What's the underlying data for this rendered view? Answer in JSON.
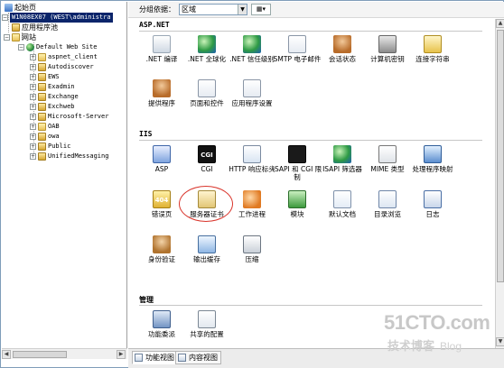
{
  "tree": {
    "start_page": "起始页",
    "server": "W1N08EX07 (WEST\\administra",
    "app_pools": "应用程序池",
    "sites": "网站",
    "default_site": "Default Web Site",
    "children": [
      "aspnet_client",
      "Autodiscover",
      "EWS",
      "Exadmin",
      "Exchange",
      "Exchweb",
      "Microsoft-Server",
      "OAB",
      "owa",
      "Public",
      "UnifiedMessaging"
    ]
  },
  "toolbar": {
    "group_label": "分组依据：",
    "group_value": "区域"
  },
  "sections": {
    "aspnet": "ASP.NET",
    "iis": "IIS",
    "manage": "管理"
  },
  "aspnet_items": [
    {
      "label": ".NET 编译",
      "icon": "net-compile-icon"
    },
    {
      "label": ".NET 全球化",
      "icon": "globalization-icon"
    },
    {
      "label": ".NET 信任级别",
      "icon": "trust-level-icon"
    },
    {
      "label": "SMTP 电子邮件",
      "icon": "smtp-email-icon"
    },
    {
      "label": "会话状态",
      "icon": "session-state-icon"
    },
    {
      "label": "计算机密钥",
      "icon": "machine-key-icon"
    },
    {
      "label": "连接字符串",
      "icon": "connection-strings-icon"
    },
    {
      "label": "提供程序",
      "icon": "providers-icon"
    },
    {
      "label": "页面和控件",
      "icon": "pages-controls-icon"
    },
    {
      "label": "应用程序设置",
      "icon": "app-settings-icon"
    }
  ],
  "iis_items": [
    {
      "label": "ASP",
      "icon": "asp-icon"
    },
    {
      "label": "CGI",
      "icon": "cgi-icon",
      "glyph": "CGI"
    },
    {
      "label": "HTTP 响应标头",
      "icon": "http-headers-icon"
    },
    {
      "label": "ISAPI 和 CGI 限制",
      "icon": "isapi-cgi-icon"
    },
    {
      "label": "ISAPI 筛选器",
      "icon": "isapi-filters-icon"
    },
    {
      "label": "MIME 类型",
      "icon": "mime-types-icon"
    },
    {
      "label": "处理程序映射",
      "icon": "handler-mappings-icon"
    },
    {
      "label": "错误页",
      "icon": "error-pages-icon",
      "glyph": "404"
    },
    {
      "label": "服务器证书",
      "icon": "server-certificates-icon"
    },
    {
      "label": "工作进程",
      "icon": "worker-processes-icon"
    },
    {
      "label": "模块",
      "icon": "modules-icon"
    },
    {
      "label": "默认文档",
      "icon": "default-document-icon"
    },
    {
      "label": "目录浏览",
      "icon": "directory-browsing-icon"
    },
    {
      "label": "日志",
      "icon": "logging-icon"
    },
    {
      "label": "身份验证",
      "icon": "authentication-icon"
    },
    {
      "label": "输出缓存",
      "icon": "output-caching-icon"
    },
    {
      "label": "压缩",
      "icon": "compression-icon"
    }
  ],
  "manage_items": [
    {
      "label": "功能委派",
      "icon": "feature-delegation-icon"
    },
    {
      "label": "共享的配置",
      "icon": "shared-configuration-icon"
    }
  ],
  "tabs": {
    "features": "功能视图",
    "content": "内容视图"
  },
  "watermark": {
    "site": "51CTO.com",
    "tagline": "技术博客",
    "blog": "Blog"
  },
  "colors": {
    "selection": "#0a246a",
    "annotation_circle": "#d9342b"
  }
}
